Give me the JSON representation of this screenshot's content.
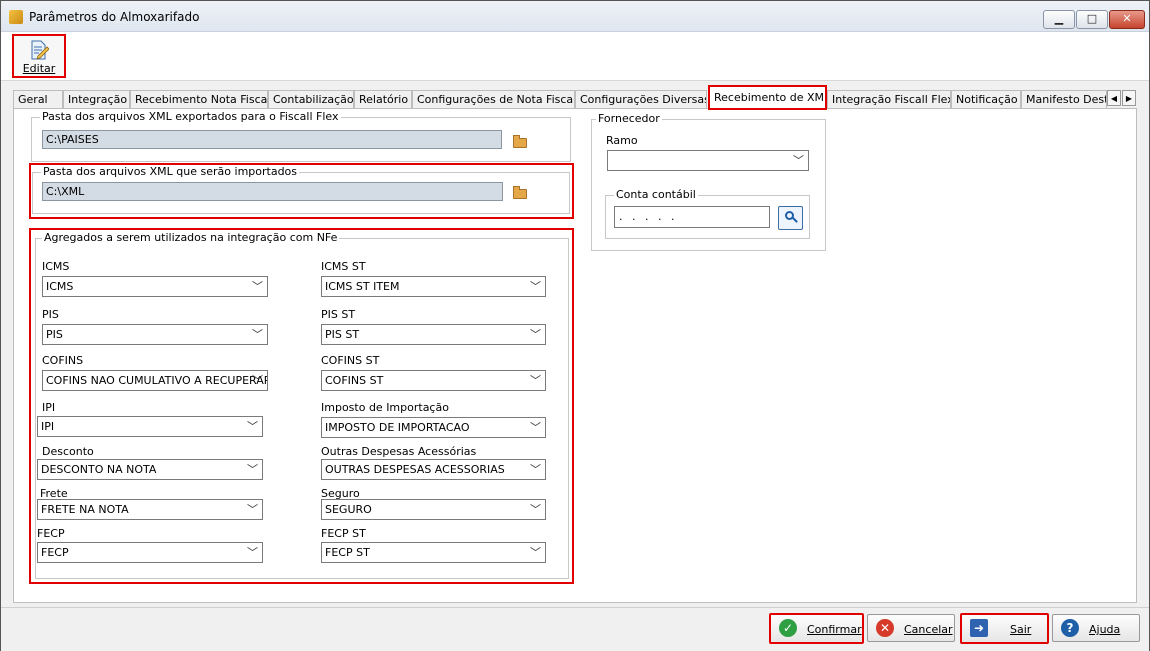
{
  "window": {
    "title": "Parâmetros do Almoxarifado",
    "minimize": "▁",
    "maximize": "□",
    "close": "✕"
  },
  "toolbar": {
    "edit_label": "Editar"
  },
  "tabs": [
    "Geral",
    "Integração",
    "Recebimento Nota Fiscal",
    "Contabilização",
    "Relatório",
    "Configurações de Nota Fiscal",
    "Configurações Diversas",
    "Recebimento de XML",
    "Integração Fiscall Flex",
    "Notificação",
    "Manifesto Dest"
  ],
  "active_tab": "Recebimento de XML",
  "tab_scroll": {
    "left": "◀",
    "right": "▶"
  },
  "export_folder": {
    "legend": "Pasta dos arquivos XML exportados para o Fiscall Flex",
    "value": "C:\\PAISES"
  },
  "import_folder": {
    "legend": "Pasta dos arquivos XML que serão importados",
    "value": "C:\\XML"
  },
  "aggregates": {
    "legend": "Agregados a serem utilizados na integração com NFe",
    "left": [
      {
        "label": "ICMS",
        "value": "ICMS"
      },
      {
        "label": "PIS",
        "value": "PIS"
      },
      {
        "label": "COFINS",
        "value": "COFINS NAO CUMULATIVO A RECUPERAR"
      },
      {
        "label": "IPI",
        "value": "IPI"
      },
      {
        "label": "Desconto",
        "value": "DESCONTO NA NOTA"
      },
      {
        "label": "Frete",
        "value": "FRETE NA NOTA"
      },
      {
        "label": "FECP",
        "value": "FECP"
      }
    ],
    "right": [
      {
        "label": "ICMS ST",
        "value": "ICMS ST ITEM"
      },
      {
        "label": "PIS ST",
        "value": "PIS ST"
      },
      {
        "label": "COFINS ST",
        "value": "COFINS ST"
      },
      {
        "label": "Imposto de Importação",
        "value": "IMPOSTO DE IMPORTACAO"
      },
      {
        "label": "Outras Despesas Acessórias",
        "value": "OUTRAS DESPESAS ACESSORIAS"
      },
      {
        "label": "Seguro",
        "value": "SEGURO"
      },
      {
        "label": "FECP ST",
        "value": "FECP ST"
      }
    ]
  },
  "supplier": {
    "legend": "Fornecedor",
    "ramo_label": "Ramo",
    "ramo_value": "",
    "account_legend": "Conta contábil",
    "account_value": ". . . . ."
  },
  "buttons": {
    "confirm": "Confirmar",
    "cancel": "Cancelar",
    "exit": "Sair",
    "help": "Ajuda"
  },
  "colors": {
    "highlight": "#e00000",
    "confirm_icon": "#2ea043",
    "cancel_icon": "#d63a2a",
    "help_icon": "#1e5fa8"
  }
}
